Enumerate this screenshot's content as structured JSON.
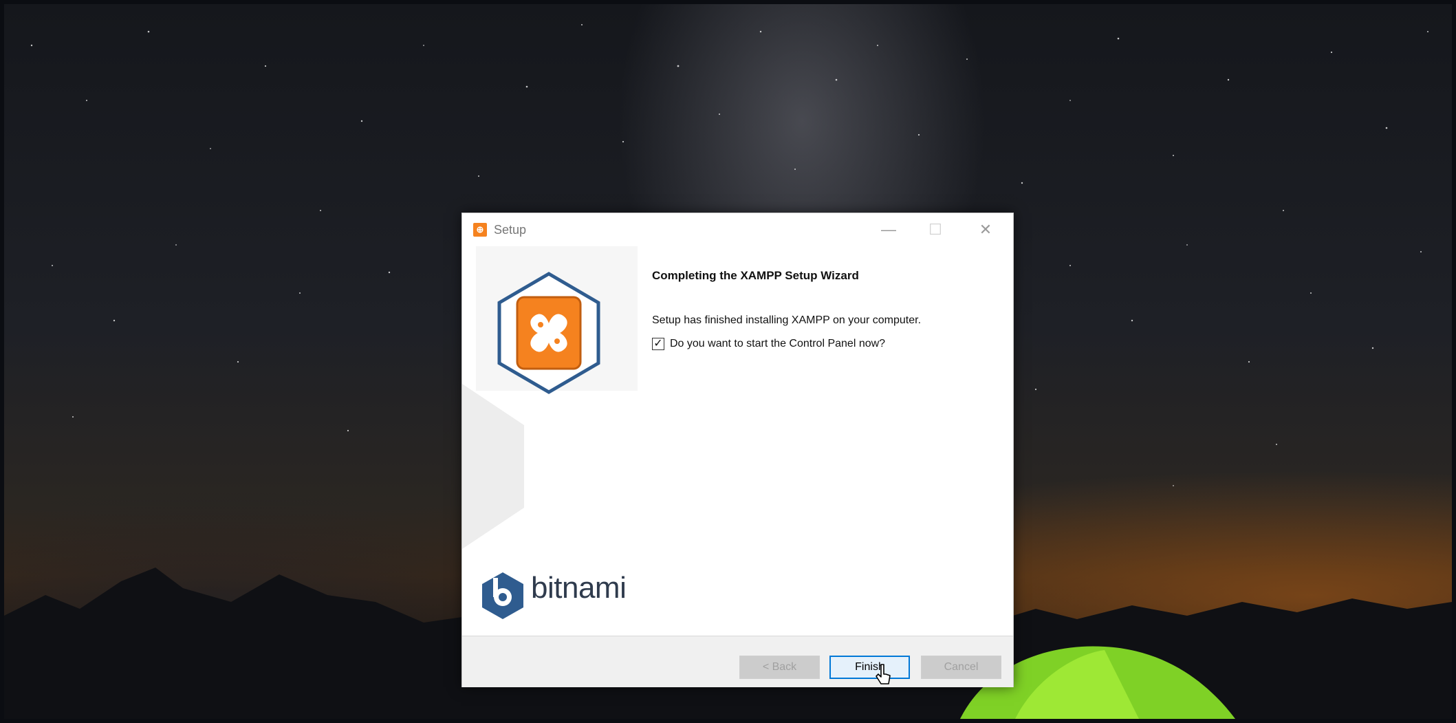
{
  "window": {
    "title": "Setup",
    "minimize_icon": "minimize-icon",
    "maximize_icon": "maximize-icon",
    "close_icon": "close-icon"
  },
  "wizard": {
    "heading": "Completing the XAMPP Setup Wizard",
    "message": "Setup has finished installing XAMPP on your computer.",
    "start_control_panel": {
      "label": "Do you want to start the Control Panel now?",
      "checked": true
    }
  },
  "branding": {
    "app_logo": "xampp-logo",
    "vendor_logo_text": "bitnami"
  },
  "buttons": {
    "back": "< Back",
    "finish": "Finish",
    "cancel": "Cancel"
  },
  "colors": {
    "xampp_orange": "#f5821f",
    "bitnami_blue": "#2f5c8f",
    "focus_blue": "#0078d7"
  }
}
